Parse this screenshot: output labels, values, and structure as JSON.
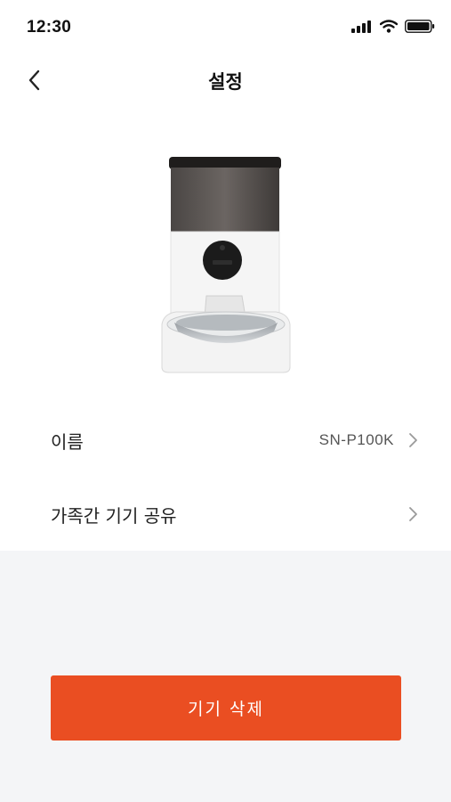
{
  "status_bar": {
    "time": "12:30",
    "icons": [
      "signal-icon",
      "wifi-icon",
      "battery-icon"
    ]
  },
  "header": {
    "title": "설정",
    "back_icon": "chevron-left-icon"
  },
  "device": {
    "image": "pet-feeder-image"
  },
  "settings": {
    "name_label": "이름",
    "name_value": "SN-P100K",
    "share_label": "가족간 기기 공유"
  },
  "actions": {
    "delete_label": "기기 삭제"
  },
  "colors": {
    "accent": "#ea4e22",
    "background": "#f4f5f7",
    "surface": "#ffffff"
  }
}
